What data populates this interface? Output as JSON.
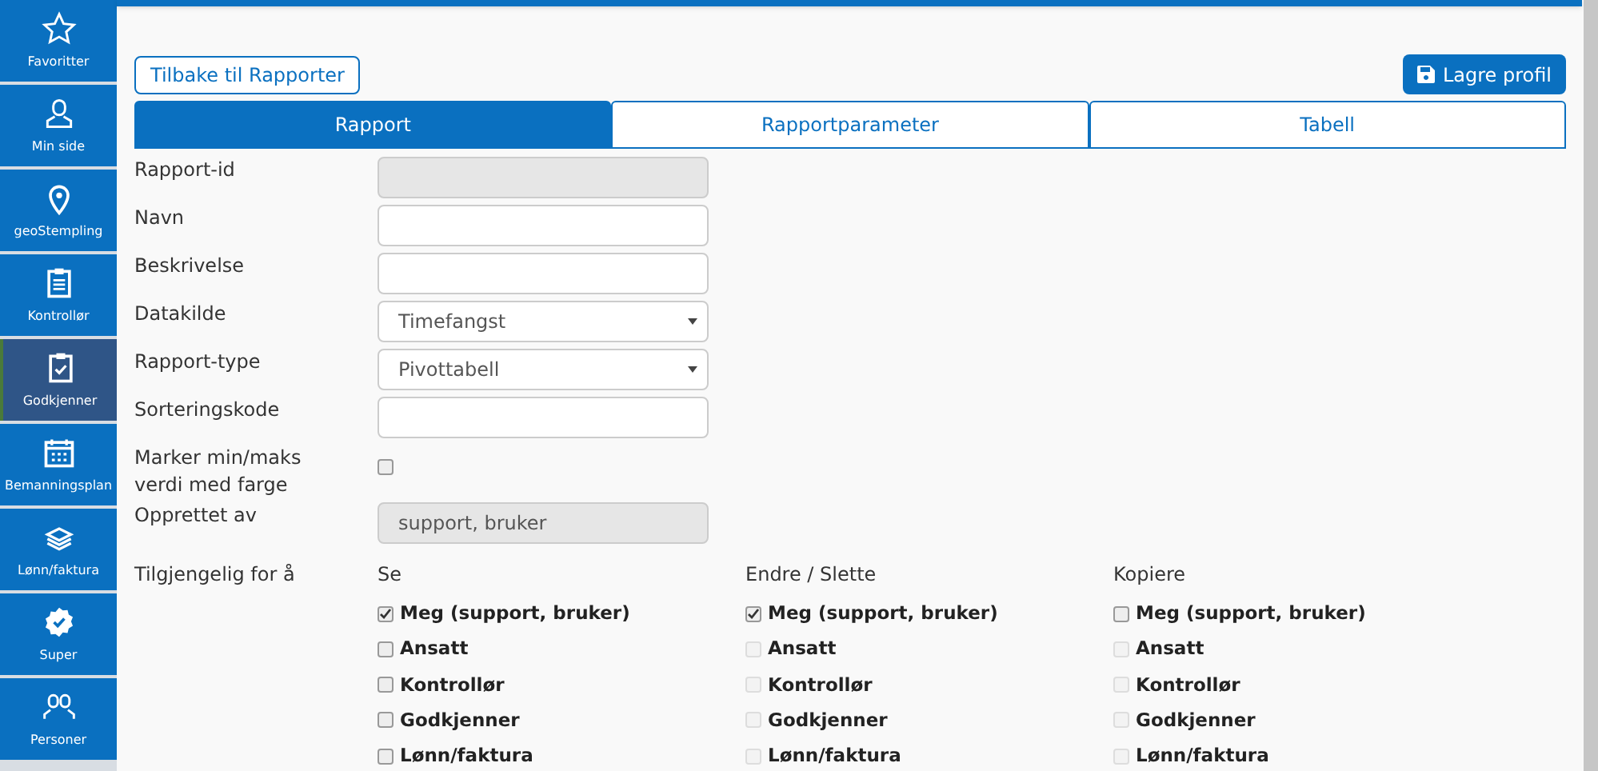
{
  "sidebar": {
    "items": [
      {
        "label": "Favoritter",
        "selected": false
      },
      {
        "label": "Min side",
        "selected": false
      },
      {
        "label": "geoStempling",
        "selected": false
      },
      {
        "label": "Kontrollør",
        "selected": false
      },
      {
        "label": "Godkjenner",
        "selected": true
      },
      {
        "label": "Bemanningsplan",
        "selected": false
      },
      {
        "label": "Lønn/faktura",
        "selected": false
      },
      {
        "label": "Super",
        "selected": false
      },
      {
        "label": "Personer",
        "selected": false
      }
    ]
  },
  "back_button": "Tilbake til Rapporter",
  "save_button": "Lagre profil",
  "tabs": [
    {
      "label": "Rapport",
      "selected": true
    },
    {
      "label": "Rapportparameter",
      "selected": false
    },
    {
      "label": "Tabell",
      "selected": false
    }
  ],
  "form": {
    "fields": [
      {
        "label": "Rapport-id",
        "kind": "text",
        "disabled": true
      },
      {
        "label": "Navn",
        "kind": "text",
        "disabled": false
      },
      {
        "label": "Beskrivelse",
        "kind": "text",
        "disabled": false
      },
      {
        "label": "Datakilde",
        "kind": "select",
        "value": "Timefangst"
      },
      {
        "label": "Rapport-type",
        "kind": "select",
        "value": "Pivottabell"
      },
      {
        "label": "Sorteringskode",
        "kind": "text",
        "disabled": false
      },
      {
        "label": "Marker min/maks verdi med farge",
        "kind": "checkbox",
        "checked": false
      },
      {
        "label": "Opprettet av",
        "kind": "text",
        "value": "support, bruker",
        "disabled": true
      }
    ]
  },
  "access": {
    "label": "Tilgjengelig for å",
    "columns": [
      {
        "heading": "Se",
        "options": [
          {
            "label": "Meg (support, bruker)",
            "checked": true,
            "disabled": false
          },
          {
            "label": "Ansatt",
            "checked": false,
            "disabled": false
          },
          {
            "label": "Kontrollør",
            "checked": false,
            "disabled": false
          },
          {
            "label": "Godkjenner",
            "checked": false,
            "disabled": false
          },
          {
            "label": "Lønn/faktura",
            "checked": false,
            "disabled": false
          }
        ]
      },
      {
        "heading": "Endre / Slette",
        "options": [
          {
            "label": "Meg (support, bruker)",
            "checked": true,
            "disabled": false
          },
          {
            "label": "Ansatt",
            "checked": false,
            "disabled": true
          },
          {
            "label": "Kontrollør",
            "checked": false,
            "disabled": true
          },
          {
            "label": "Godkjenner",
            "checked": false,
            "disabled": true
          },
          {
            "label": "Lønn/faktura",
            "checked": false,
            "disabled": true
          }
        ]
      },
      {
        "heading": "Kopiere",
        "options": [
          {
            "label": "Meg (support, bruker)",
            "checked": false,
            "disabled": false
          },
          {
            "label": "Ansatt",
            "checked": false,
            "disabled": true
          },
          {
            "label": "Kontrollør",
            "checked": false,
            "disabled": true
          },
          {
            "label": "Godkjenner",
            "checked": false,
            "disabled": true
          },
          {
            "label": "Lønn/faktura",
            "checked": false,
            "disabled": true
          }
        ]
      }
    ]
  }
}
